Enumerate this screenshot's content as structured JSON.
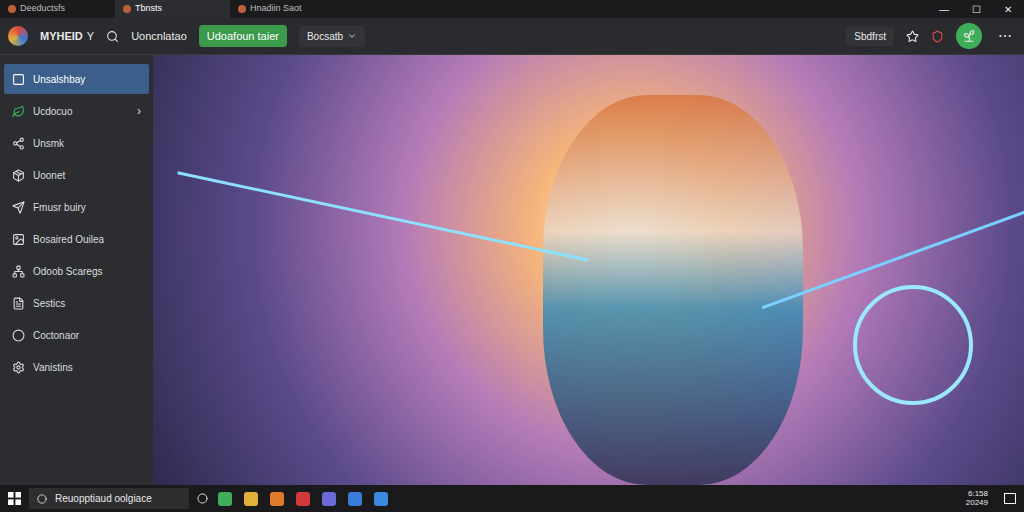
{
  "window": {
    "controls": [
      "—",
      "☐",
      "✕"
    ]
  },
  "tabs": [
    {
      "label": "Deeductsfs",
      "selected": false
    },
    {
      "label": "Tbnsts",
      "selected": true
    },
    {
      "label": "Hnadiin Saot",
      "selected": false
    }
  ],
  "toolbar": {
    "brand": "MYHEID",
    "brand_suffix": "Y",
    "link": "Uoncnlatao",
    "primary_button": "Udoafoun taier",
    "dropdown": "Bocsatb",
    "right_label": "Sbdfrst",
    "more": "⋯"
  },
  "sidebar": {
    "items": [
      {
        "label": "Unsalshbay",
        "selected": true,
        "arrow": ""
      },
      {
        "label": "Ucdocuo",
        "selected": false,
        "arrow": "›"
      },
      {
        "label": "Unsmk",
        "selected": false,
        "arrow": ""
      },
      {
        "label": "Uoonet",
        "selected": false,
        "arrow": ""
      },
      {
        "label": "Fmusr buiry",
        "selected": false,
        "arrow": ""
      },
      {
        "label": "Bosaired Ouilea",
        "selected": false,
        "arrow": ""
      },
      {
        "label": "Odoob Scaregs",
        "selected": false,
        "arrow": ""
      },
      {
        "label": "Sestics",
        "selected": false,
        "arrow": ""
      },
      {
        "label": "Coctonaor",
        "selected": false,
        "arrow": ""
      },
      {
        "label": "Vanistins",
        "selected": false,
        "arrow": ""
      }
    ]
  },
  "taskbar": {
    "search": "Reuopptiaud oolgiace",
    "time": "6:158",
    "date": "20249",
    "apps": [
      {
        "color": "#3fae5a"
      },
      {
        "color": "#e0b03a"
      },
      {
        "color": "#e07a2a"
      },
      {
        "color": "#d03a3a"
      },
      {
        "color": "#6a6ad8"
      },
      {
        "color": "#3a7ad8"
      },
      {
        "color": "#3a8ae0"
      }
    ]
  }
}
